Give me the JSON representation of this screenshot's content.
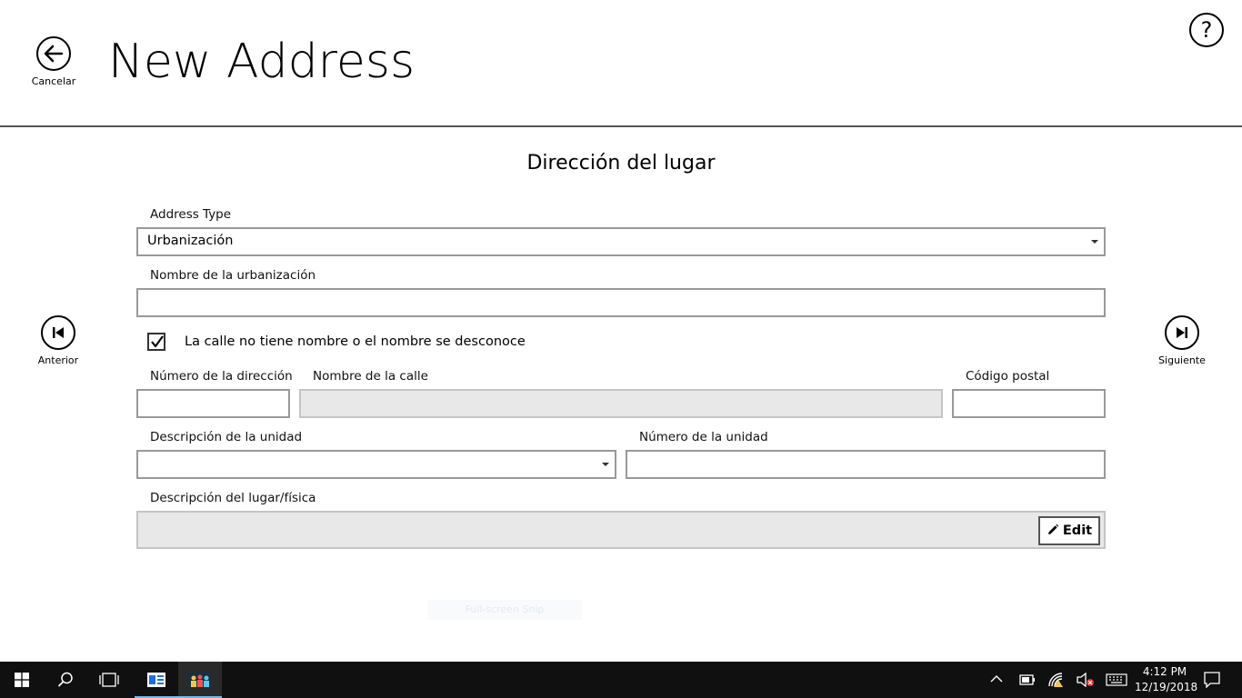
{
  "header": {
    "back_label": "Cancelar",
    "title": "New Address",
    "help_symbol": "?"
  },
  "section": {
    "title": "Dirección del lugar"
  },
  "nav": {
    "previous_label": "Anterior",
    "next_label": "Siguiente"
  },
  "form": {
    "address_type_label": "Address Type",
    "address_type_value": "Urbanización",
    "urbanization_label": "Nombre de la urbanización",
    "urbanization_value": "",
    "unnamed_street_label": "La calle no tiene nombre o el nombre se desconoce",
    "unnamed_street_checked": true,
    "address_number_label": "Número de la dirección",
    "street_name_label": "Nombre de la calle",
    "postal_code_label": "Código postal",
    "unit_description_label": "Descripción de la unidad",
    "unit_number_label": "Número de la unidad",
    "place_description_label": "Descripción del lugar/física",
    "edit_label": "Edit"
  },
  "overlay": {
    "faint_text": "Full-screen Snip"
  },
  "taskbar": {
    "time": "4:12 PM",
    "date": "12/19/2018"
  },
  "colors": {
    "taskbar_bg": "#101010",
    "disabled_field": "#e8e8e8",
    "running_indicator": "#76b9ed"
  }
}
